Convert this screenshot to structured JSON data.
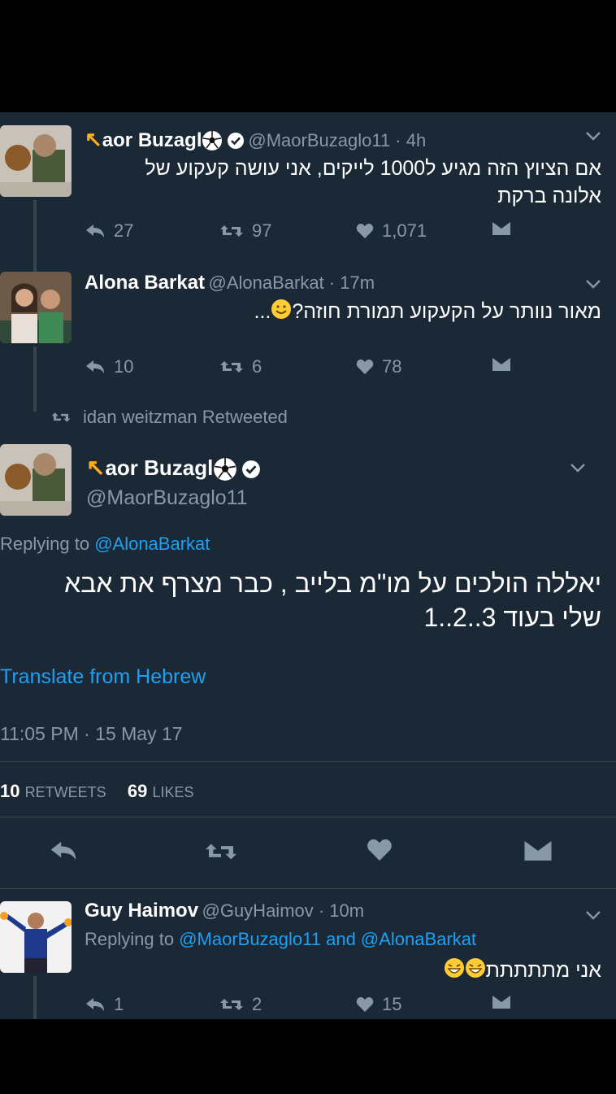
{
  "tweet1": {
    "name": "ᠰaor Buzagl",
    "name_prefix": "ᖰ",
    "name_main": "aor Buzagl",
    "handle_time": "@MaorBuzaglo11 · 4h",
    "text_line1": "אם הציוץ הזה מגיע ל1000 לייקים, אני עושה קעקוע של",
    "text_line2": "אלונה ברקת",
    "replies": "27",
    "retweets": "97",
    "likes": "1,071"
  },
  "tweet2": {
    "name": "Alona Barkat",
    "handle_time": "@AlonaBarkat · 17m",
    "text": "מאור נוותר על הקעקוע תמורת חוזה?",
    "emoji_suffix": "...",
    "replies": "10",
    "retweets": "6",
    "likes": "78"
  },
  "retweet_notice": "idan weitzman Retweeted",
  "main_tweet": {
    "name_main": "aor Buzagl",
    "handle": "@MaorBuzaglo11",
    "replying_prefix": "Replying to ",
    "replying_to": "@AlonaBarkat",
    "text_line1": "יאללה הולכים על מו\"מ בלייב , כבר מצרף את אבא",
    "text_line2": "שלי בעוד 3..2..1",
    "translate": "Translate from Hebrew",
    "timestamp": "11:05 PM · 15 May 17",
    "retweet_count": "10",
    "retweet_label": "RETWEETS",
    "like_count": "69",
    "like_label": "LIKES"
  },
  "tweet3": {
    "name": "Guy Haimov",
    "handle_time": "@GuyHaimov · 10m",
    "replying_prefix": "Replying to ",
    "replying_to": "@MaorBuzaglo11 and @AlonaBarkat",
    "text": "אני מתתתתת",
    "replies": "1",
    "retweets": "2",
    "likes": "15"
  },
  "colors": {
    "background": "#1b2836",
    "text": "#ffffff",
    "secondary": "#8899a6",
    "link": "#1da1f2",
    "accent_yellow": "#ffad1f"
  },
  "icons": [
    "reply-icon",
    "retweet-icon",
    "heart-icon",
    "dm-icon",
    "verified-icon",
    "soccer-ball-icon",
    "chevron-down-icon"
  ]
}
